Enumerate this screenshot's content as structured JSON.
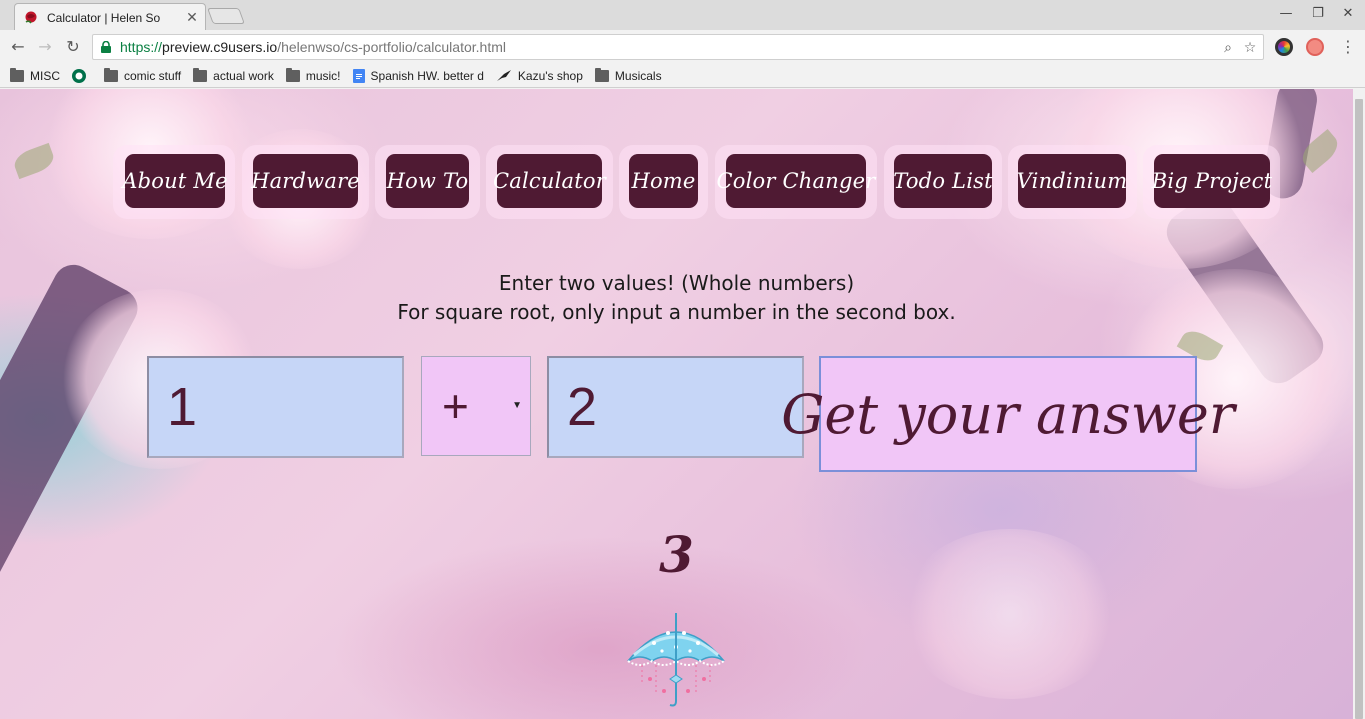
{
  "browser": {
    "tab_title": "Calculator | Helen So",
    "url_scheme": "https://",
    "url_host": "preview.c9users.io",
    "url_path": "/helenwso/cs-portfolio/calculator.html",
    "bookmarks": [
      {
        "label": "MISC",
        "icon": "folder-icon"
      },
      {
        "label": "",
        "icon": "starbucks-icon"
      },
      {
        "label": "comic stuff",
        "icon": "folder-icon"
      },
      {
        "label": "actual work",
        "icon": "folder-icon"
      },
      {
        "label": "music!",
        "icon": "folder-icon"
      },
      {
        "label": "Spanish HW. better d",
        "icon": "google-docs-icon"
      },
      {
        "label": "Kazu's shop",
        "icon": "bird-icon"
      },
      {
        "label": "Musicals",
        "icon": "folder-icon"
      }
    ]
  },
  "nav": {
    "items": [
      {
        "label": "About Me"
      },
      {
        "label": "Hardware"
      },
      {
        "label": "How To"
      },
      {
        "label": "Calculator"
      },
      {
        "label": "Home"
      },
      {
        "label": "Color Changer"
      },
      {
        "label": "Todo List"
      },
      {
        "label": "Vindinium"
      },
      {
        "label": "Big Project"
      }
    ]
  },
  "calculator": {
    "instruction_line1": "Enter two values! (Whole numbers)",
    "instruction_line2": "For square root, only input a number in the second box.",
    "first_value": "1",
    "operator": "+",
    "second_value": "2",
    "button_label": "Get your answer",
    "result": "3"
  },
  "colors": {
    "accent": "#4f1a33",
    "input_bg": "#c6d6f7",
    "button_bg": "#f1c6f7"
  }
}
